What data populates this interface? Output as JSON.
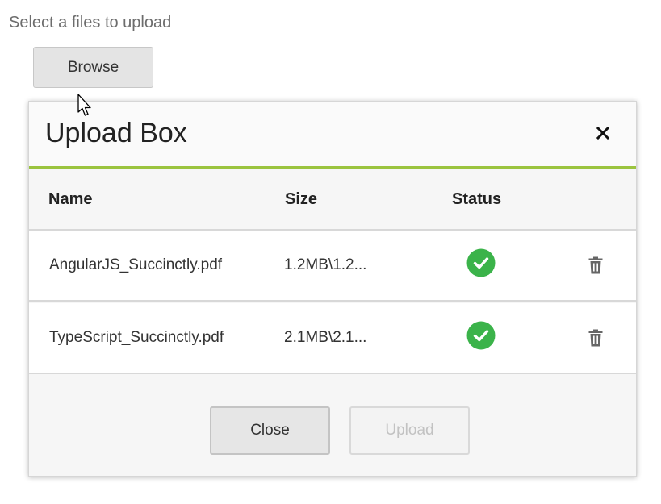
{
  "prompt_text": "Select a files to upload",
  "browse_label": "Browse",
  "dialog": {
    "title": "Upload Box",
    "columns": {
      "name": "Name",
      "size": "Size",
      "status": "Status"
    },
    "files": [
      {
        "name": "AngularJS_Succinctly.pdf",
        "size": "1.2MB\\1.2...",
        "status": "success"
      },
      {
        "name": "TypeScript_Succinctly.pdf",
        "size": "2.1MB\\2.1...",
        "status": "success"
      }
    ],
    "close_label": "Close",
    "upload_label": "Upload"
  },
  "colors": {
    "accent": "#9bc43f",
    "success": "#3bb34a"
  },
  "icons": {
    "close": "close-icon",
    "status": "check-circle-icon",
    "delete": "trash-icon",
    "cursor": "mouse-pointer-icon"
  }
}
